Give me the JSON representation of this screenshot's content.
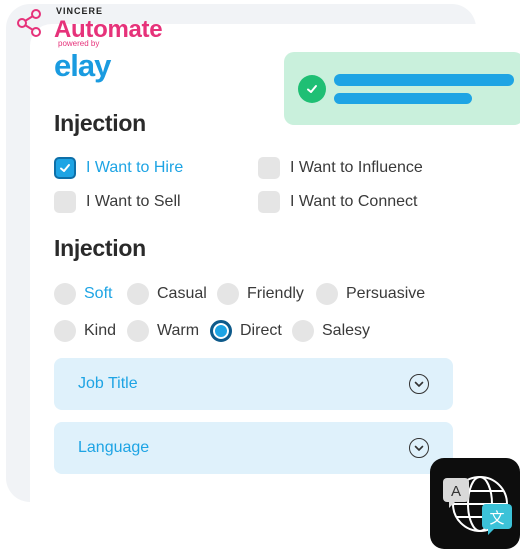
{
  "brand": {
    "vincere": "VINCERE",
    "automate": "Automate",
    "powered_by": "powered by",
    "elay": "elay"
  },
  "sections": [
    {
      "title": "Injection"
    },
    {
      "title": "Injection"
    }
  ],
  "intents": [
    {
      "label": "I Want to Hire",
      "checked": true
    },
    {
      "label": "I Want to Influence",
      "checked": false
    },
    {
      "label": "I Want to Sell",
      "checked": false
    },
    {
      "label": "I Want to Connect",
      "checked": false
    }
  ],
  "tones": [
    {
      "label": "Soft",
      "active": true
    },
    {
      "label": "Casual",
      "active": false
    },
    {
      "label": "Friendly",
      "active": false
    },
    {
      "label": "Persuasive",
      "active": false
    },
    {
      "label": "Kind",
      "active": false
    },
    {
      "label": "Warm",
      "active": false
    },
    {
      "label": "Direct",
      "selected": true
    },
    {
      "label": "Salesy",
      "active": false
    }
  ],
  "dropdowns": [
    {
      "label": "Job Title"
    },
    {
      "label": "Language"
    }
  ],
  "translate_tile": {
    "glyph_a": "A",
    "glyph_zh": "文"
  },
  "colors": {
    "brand_pink": "#e6327a",
    "brand_blue": "#1a9be0",
    "accent": "#1ea4e4",
    "success": "#1fbf74",
    "toast_bg": "#c9f0dc",
    "dropdown_bg": "#dff1fb"
  }
}
